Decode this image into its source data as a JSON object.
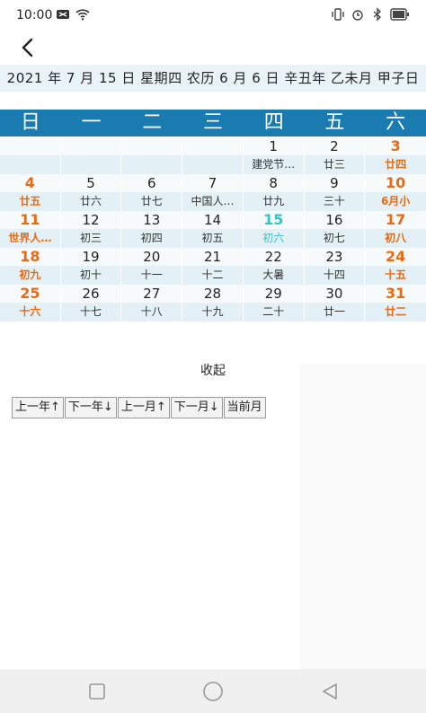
{
  "status": {
    "time": "10:00"
  },
  "date_bar": "2021 年 7 月 15 日 星期四 农历 6 月 6 日 辛丑年 乙未月 甲子日",
  "weekdays": [
    "日",
    "一",
    "二",
    "三",
    "四",
    "五",
    "六"
  ],
  "weeks": [
    [
      {
        "d": "",
        "s": ""
      },
      {
        "d": "",
        "s": ""
      },
      {
        "d": "",
        "s": ""
      },
      {
        "d": "",
        "s": ""
      },
      {
        "d": "1",
        "s": "建党节…"
      },
      {
        "d": "2",
        "s": "廿三"
      },
      {
        "d": "3",
        "s": "廿四"
      }
    ],
    [
      {
        "d": "4",
        "s": "廿五"
      },
      {
        "d": "5",
        "s": "廿六"
      },
      {
        "d": "6",
        "s": "廿七"
      },
      {
        "d": "7",
        "s": "中国人…"
      },
      {
        "d": "8",
        "s": "廿九"
      },
      {
        "d": "9",
        "s": "三十"
      },
      {
        "d": "10",
        "s": "6月小"
      }
    ],
    [
      {
        "d": "11",
        "s": "世界人…"
      },
      {
        "d": "12",
        "s": "初三"
      },
      {
        "d": "13",
        "s": "初四"
      },
      {
        "d": "14",
        "s": "初五"
      },
      {
        "d": "15",
        "s": "初六"
      },
      {
        "d": "16",
        "s": "初七"
      },
      {
        "d": "17",
        "s": "初八"
      }
    ],
    [
      {
        "d": "18",
        "s": "初九"
      },
      {
        "d": "19",
        "s": "初十"
      },
      {
        "d": "20",
        "s": "十一"
      },
      {
        "d": "21",
        "s": "十二"
      },
      {
        "d": "22",
        "s": "大暑"
      },
      {
        "d": "23",
        "s": "十四"
      },
      {
        "d": "24",
        "s": "十五"
      }
    ],
    [
      {
        "d": "25",
        "s": "十六"
      },
      {
        "d": "26",
        "s": "十七"
      },
      {
        "d": "27",
        "s": "十八"
      },
      {
        "d": "28",
        "s": "十九"
      },
      {
        "d": "29",
        "s": "二十"
      },
      {
        "d": "30",
        "s": "廿一"
      },
      {
        "d": "31",
        "s": "廿二"
      }
    ]
  ],
  "today": "15",
  "collapse_label": "收起",
  "buttons": {
    "prev_year": "上一年↑",
    "next_year": "下一年↓",
    "prev_month": "上一月↑",
    "next_month": "下一月↓",
    "current_month": "当前月"
  },
  "colors": {
    "header_bg": "#1a7bb0",
    "weekend": "#ea6a14",
    "today": "#36c2c9",
    "date_bar_bg": "#eaf4f8"
  },
  "icons": {
    "back": "back-arrow-icon",
    "nav_recent": "square-icon",
    "nav_home": "circle-icon",
    "nav_back": "triangle-icon"
  }
}
